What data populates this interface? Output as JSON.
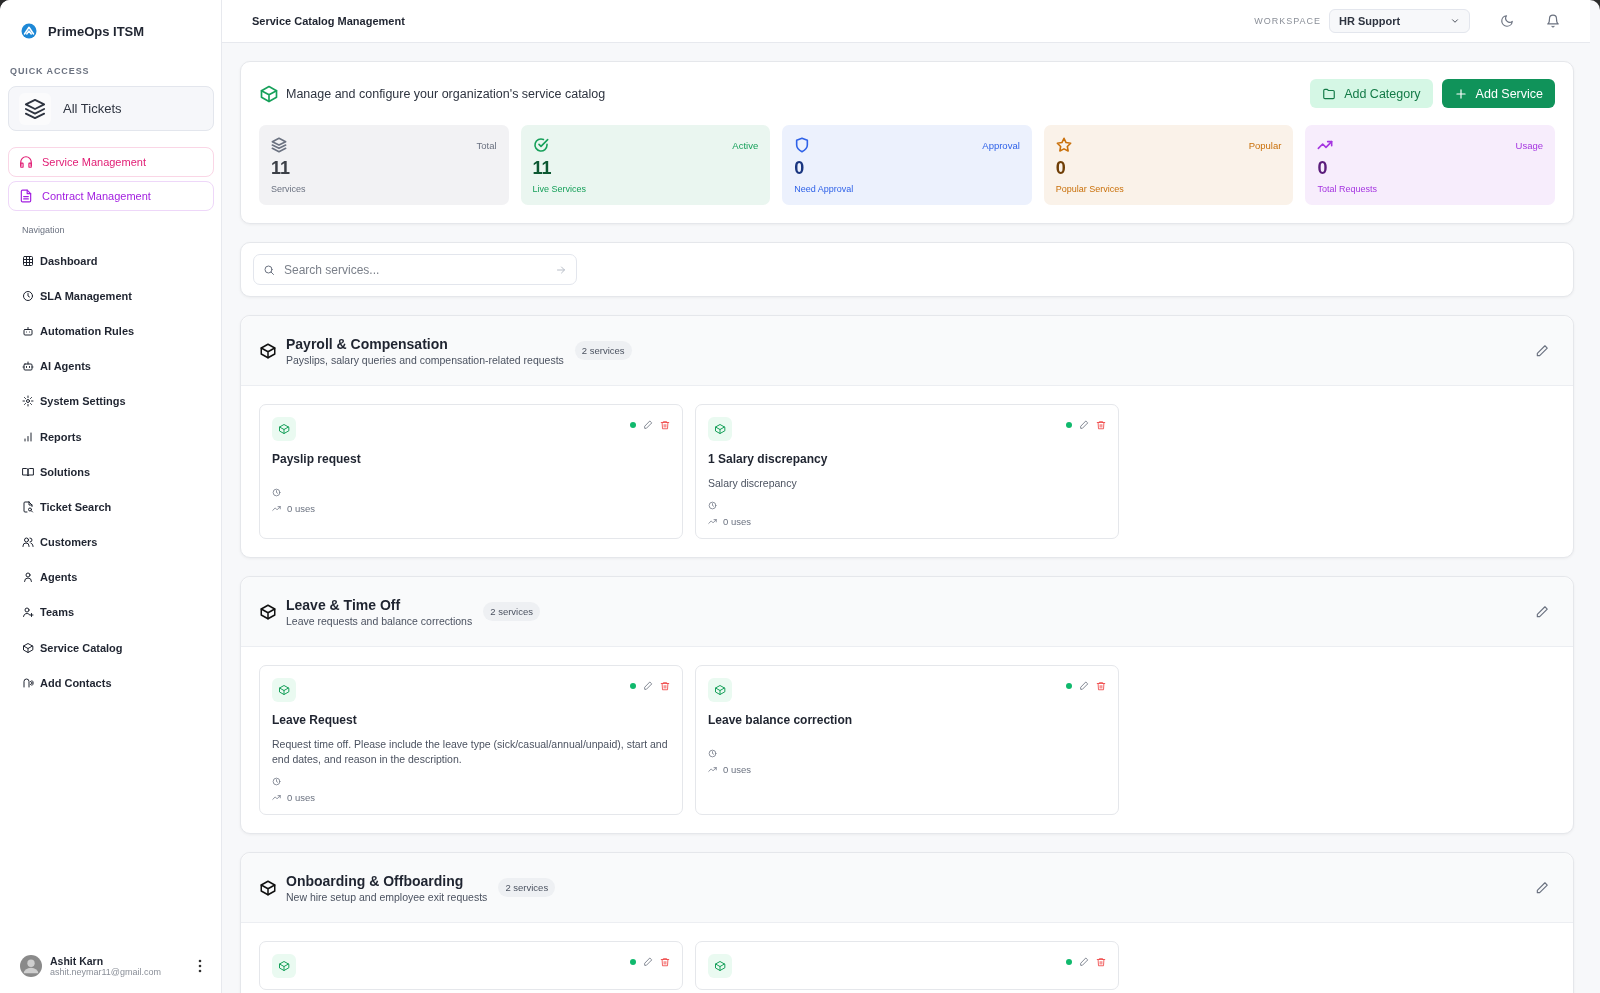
{
  "app": {
    "name": "PrimeOps ITSM"
  },
  "quick_access": {
    "label": "QUICK ACCESS",
    "items": [
      {
        "label": "All Tickets"
      }
    ]
  },
  "modules": [
    {
      "label": "Service Management",
      "color": "#e11d74"
    },
    {
      "label": "Contract Management",
      "color": "#a21fe0"
    }
  ],
  "navigation": {
    "label": "Navigation",
    "items": [
      {
        "label": "Dashboard"
      },
      {
        "label": "SLA Management"
      },
      {
        "label": "Automation Rules"
      },
      {
        "label": "AI Agents"
      },
      {
        "label": "System Settings"
      },
      {
        "label": "Reports"
      },
      {
        "label": "Solutions"
      },
      {
        "label": "Ticket Search"
      },
      {
        "label": "Customers"
      },
      {
        "label": "Agents"
      },
      {
        "label": "Teams"
      },
      {
        "label": "Service Catalog"
      },
      {
        "label": "Add Contacts"
      }
    ]
  },
  "user": {
    "name": "Ashit Karn",
    "email": "ashit.neymar11@gmail.com"
  },
  "header": {
    "title": "Service Catalog Management",
    "workspace_label": "WORKSPACE",
    "workspace": "HR Support"
  },
  "overview": {
    "description": "Manage and configure your organization's service catalog",
    "buttons": [
      {
        "label": "Add Category",
        "kind": "secondary"
      },
      {
        "label": "Add Service",
        "kind": "primary"
      }
    ],
    "stats": [
      {
        "tag": "Total",
        "value": "11",
        "label": "Services",
        "color": "#6b7280"
      },
      {
        "tag": "Active",
        "value": "11",
        "label": "Live Services",
        "color": "#16a05a"
      },
      {
        "tag": "Approval",
        "value": "0",
        "label": "Need Approval",
        "color": "#2f62e8"
      },
      {
        "tag": "Popular",
        "value": "0",
        "label": "Popular Services",
        "color": "#c9700a"
      },
      {
        "tag": "Usage",
        "value": "0",
        "label": "Total Requests",
        "color": "#a535e0"
      }
    ]
  },
  "search": {
    "placeholder": "Search services..."
  },
  "categories": [
    {
      "name": "Payroll & Compensation",
      "description": "Payslips, salary queries and compensation-related requests",
      "count": "2 services",
      "services": [
        {
          "title": "Payslip request",
          "active": true,
          "uses": "0 uses"
        },
        {
          "title": "1 Salary discrepancy",
          "description": "Salary discrepancy",
          "active": true,
          "uses": "0 uses"
        }
      ]
    },
    {
      "name": "Leave & Time Off",
      "description": "Leave requests and balance corrections",
      "count": "2 services",
      "services": [
        {
          "title": "Leave Request",
          "description": "Request time off. Please include the leave type (sick/casual/annual/unpaid), start and end dates, and reason in the description.",
          "active": true,
          "uses": "0 uses"
        },
        {
          "title": "Leave balance correction",
          "active": true,
          "uses": "0 uses"
        }
      ]
    },
    {
      "name": "Onboarding & Offboarding",
      "description": "New hire setup and employee exit requests",
      "count": "2 services",
      "services": [
        {
          "active": true
        },
        {
          "active": true
        }
      ]
    }
  ]
}
